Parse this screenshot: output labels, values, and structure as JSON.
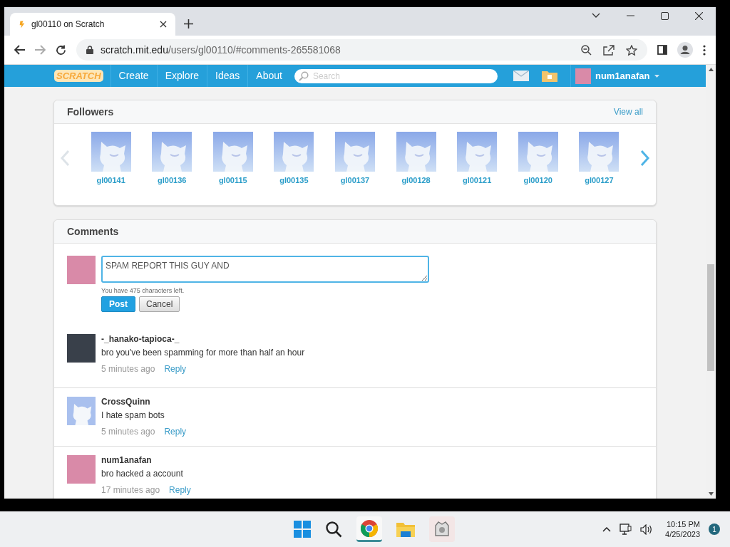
{
  "browser": {
    "tab_title": "gl00110 on Scratch",
    "url_host": "scratch.mit.edu",
    "url_path": "/users/gl00110/#comments-265581068"
  },
  "nav": {
    "logo": "SCRATCH",
    "links": [
      "Create",
      "Explore",
      "Ideas",
      "About"
    ],
    "search_placeholder": "Search",
    "username": "num1anafan"
  },
  "followers": {
    "title": "Followers",
    "view_all": "View all",
    "users": [
      "gl00141",
      "gl00136",
      "gl00115",
      "gl00135",
      "gl00137",
      "gl00128",
      "gl00121",
      "gl00120",
      "gl00127"
    ]
  },
  "comments": {
    "title": "Comments",
    "draft": "SPAM REPORT THIS GUY AND",
    "chars_left": "You have 475 characters left.",
    "post": "Post",
    "cancel": "Cancel",
    "items": [
      {
        "author": "-_hanako-tapioca-_",
        "kind": "custom",
        "text": "bro you've been spamming for more than half an hour",
        "time": "5 minutes ago",
        "reply": "Reply"
      },
      {
        "author": "CrossQuinn",
        "kind": "default",
        "text": "I hate spam bots",
        "time": "5 minutes ago",
        "reply": "Reply"
      },
      {
        "author": "num1anafan",
        "kind": "custom",
        "text": "bro hacked a account",
        "time": "17 minutes ago",
        "reply": "Reply"
      }
    ]
  },
  "taskbar": {
    "time": "10:15 PM",
    "date": "4/25/2023",
    "notifications": "1"
  }
}
